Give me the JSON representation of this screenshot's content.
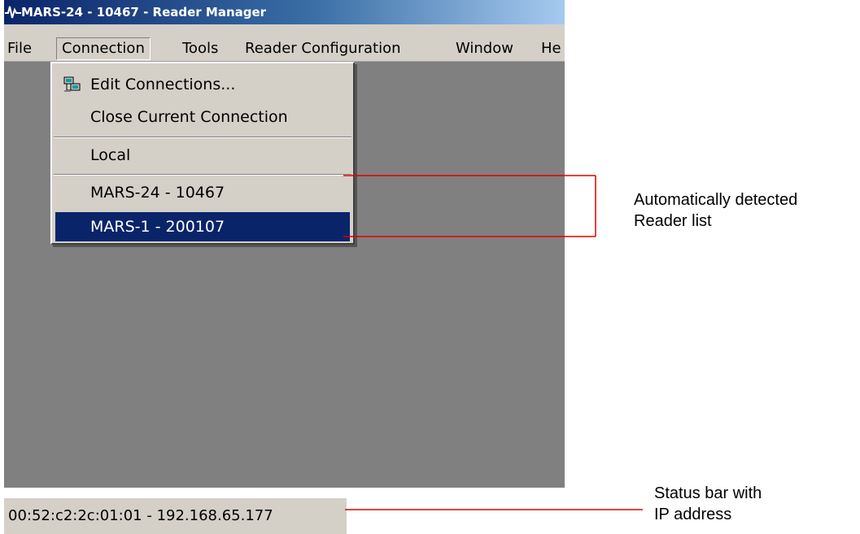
{
  "window": {
    "title": "MARS-24 - 10467 - Reader Manager"
  },
  "menubar": {
    "items": [
      "File",
      "Connection",
      "Tools",
      "Reader Configuration",
      "Window",
      "He"
    ]
  },
  "dropdown": {
    "edit_connections": "Edit Connections...",
    "close_current": "Close Current Connection",
    "local": "Local",
    "reader_1": "MARS-24 - 10467",
    "reader_2": "MARS-1 - 200107",
    "selected": "MARS-1 - 200107"
  },
  "statusbar": {
    "text": "00:52:c2:2c:01:01 - 192.168.65.177"
  },
  "annotations": {
    "reader_list_line1": "Automatically detected",
    "reader_list_line2": "Reader list",
    "status_line1": "Status bar with",
    "status_line2": "IP address"
  },
  "colors": {
    "highlight": "#0a246a",
    "annotation_line": "#e00000",
    "workspace": "#808080",
    "menu_bg": "#d4d0c8"
  }
}
